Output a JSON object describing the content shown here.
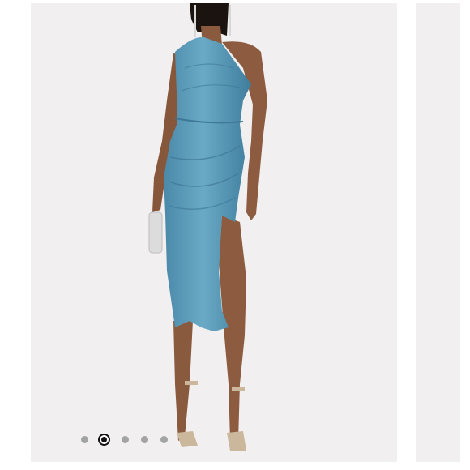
{
  "carousel": {
    "slide_count": 5,
    "active_index": 1
  },
  "product_image": {
    "dress_color": "#5b9ab7",
    "background_color": "#f1eff0"
  }
}
